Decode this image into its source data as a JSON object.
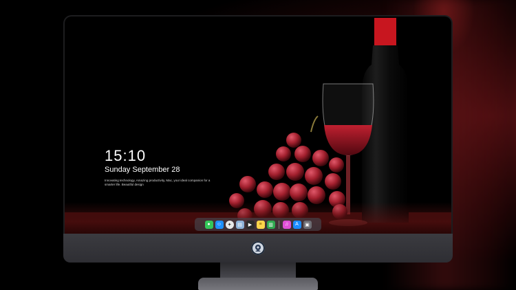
{
  "lock_screen": {
    "time": "15:10",
    "date": "Sunday September 28",
    "tagline": "Innovating technology, Amazing productivity, Mac, your ideal companion for a smarter life. Beautiful design"
  },
  "dock": {
    "apps": [
      {
        "name": "messages-icon",
        "color": "#34c759"
      },
      {
        "name": "finder-icon",
        "color": "#1e90ff"
      },
      {
        "name": "safari-icon",
        "color": "#e8e8e8"
      },
      {
        "name": "preview-icon",
        "color": "#8fb3d9"
      },
      {
        "name": "final-cut-icon",
        "color": "#2a2a2a"
      },
      {
        "name": "notes-icon",
        "color": "#ffd54a"
      },
      {
        "name": "numbers-icon",
        "color": "#2fa84f"
      }
    ],
    "apps_right": [
      {
        "name": "itunes-icon",
        "color": "#e24fd6"
      },
      {
        "name": "app-store-icon",
        "color": "#1a8cff"
      },
      {
        "name": "screenshot-icon",
        "color": "#6e6e74"
      }
    ]
  }
}
